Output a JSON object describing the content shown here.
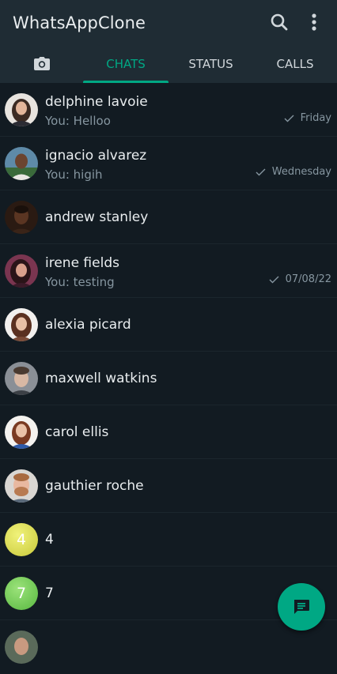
{
  "app": {
    "title": "WhatsAppClone"
  },
  "tabs": [
    {
      "label": "CHATS"
    },
    {
      "label": "STATUS"
    },
    {
      "label": "CALLS"
    }
  ],
  "chats": [
    {
      "name": "delphine lavoie",
      "preview": "You: Helloo",
      "time": "Friday"
    },
    {
      "name": "ignacio alvarez",
      "preview": "You: higih",
      "time": "Wednesday"
    },
    {
      "name": "andrew stanley"
    },
    {
      "name": "irene fields",
      "preview": "You: testing",
      "time": "07/08/22"
    },
    {
      "name": "alexia picard"
    },
    {
      "name": "maxwell watkins"
    },
    {
      "name": "carol ellis"
    },
    {
      "name": "gauthier roche"
    },
    {
      "name": "4",
      "avatar_letter": "4"
    },
    {
      "name": "7",
      "avatar_letter": "7"
    }
  ],
  "colors": {
    "accent": "#00a884",
    "background": "#121b22",
    "header": "#1f2c34"
  },
  "icons": {
    "search": "search-icon",
    "menu": "more-vertical-icon",
    "camera": "camera-icon",
    "fab": "chat-icon"
  }
}
